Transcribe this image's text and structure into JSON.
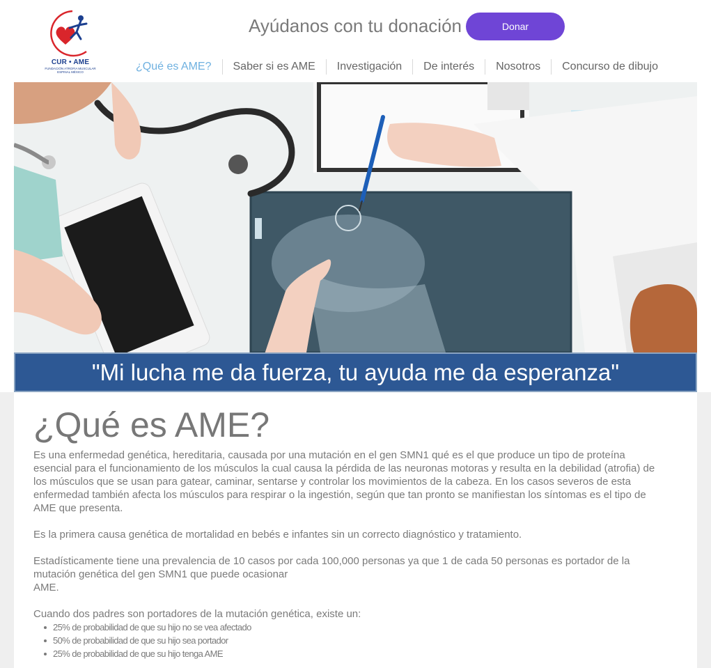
{
  "header": {
    "logo": {
      "text": "CUR • AME",
      "subtitle": "FUNDACIÓN ATROFIA MUSCULAR ESPINAL MÉXICO"
    },
    "donate_prompt": "Ayúdanos con tu donación",
    "donate_button": "Donar",
    "nav": [
      {
        "label": "¿Qué es AME?",
        "active": true
      },
      {
        "label": "Saber si es AME",
        "active": false
      },
      {
        "label": "Investigación",
        "active": false
      },
      {
        "label": "De interés",
        "active": false
      },
      {
        "label": "Nosotros",
        "active": false
      },
      {
        "label": "Concurso de dibujo",
        "active": false
      }
    ]
  },
  "banner": {
    "quote": "\"Mi lucha me da fuerza, tu ayuda me da esperanza\""
  },
  "main": {
    "title": "¿Qué es AME?",
    "paragraphs": [
      "Es una enfermedad genética, hereditaria, causada por una mutación en el gen SMN1 qué es el que produce un tipo de proteína esencial para el funcionamiento de los músculos la cual causa la pérdida de las neuronas motoras y resulta en la debilidad (atrofia) de los músculos que se usan para gatear, caminar, sentarse y controlar los movimientos de la cabeza. En los casos severos de esta enfermedad también afecta los músculos para respirar o la ingestión, según que tan pronto se manifiestan los síntomas es el tipo de AME que presenta.",
      "Es la primera causa genética de mortalidad en bebés e infantes sin un correcto diagnóstico y tratamiento.",
      "Estadísticamente tiene una prevalencia de 10 casos por cada 100,000 personas ya que 1 de cada 50 personas es portador de la mutación genética del gen SMN1 que puede ocasionar\nAME.",
      "Cuando dos padres son portadores de la mutación genética, existe un:"
    ],
    "bullets": [
      "25% de probabilidad de que su hijo no se vea afectado",
      "50% de probabilidad de que su hijo sea portador",
      "25% de probabilidad de que su hijo tenga AME"
    ]
  },
  "colors": {
    "accent_purple": "#6f45d6",
    "nav_active": "#6fb1e0",
    "banner_blue": "#2d5894",
    "logo_red": "#d9252b",
    "logo_blue": "#1c3f8f"
  }
}
